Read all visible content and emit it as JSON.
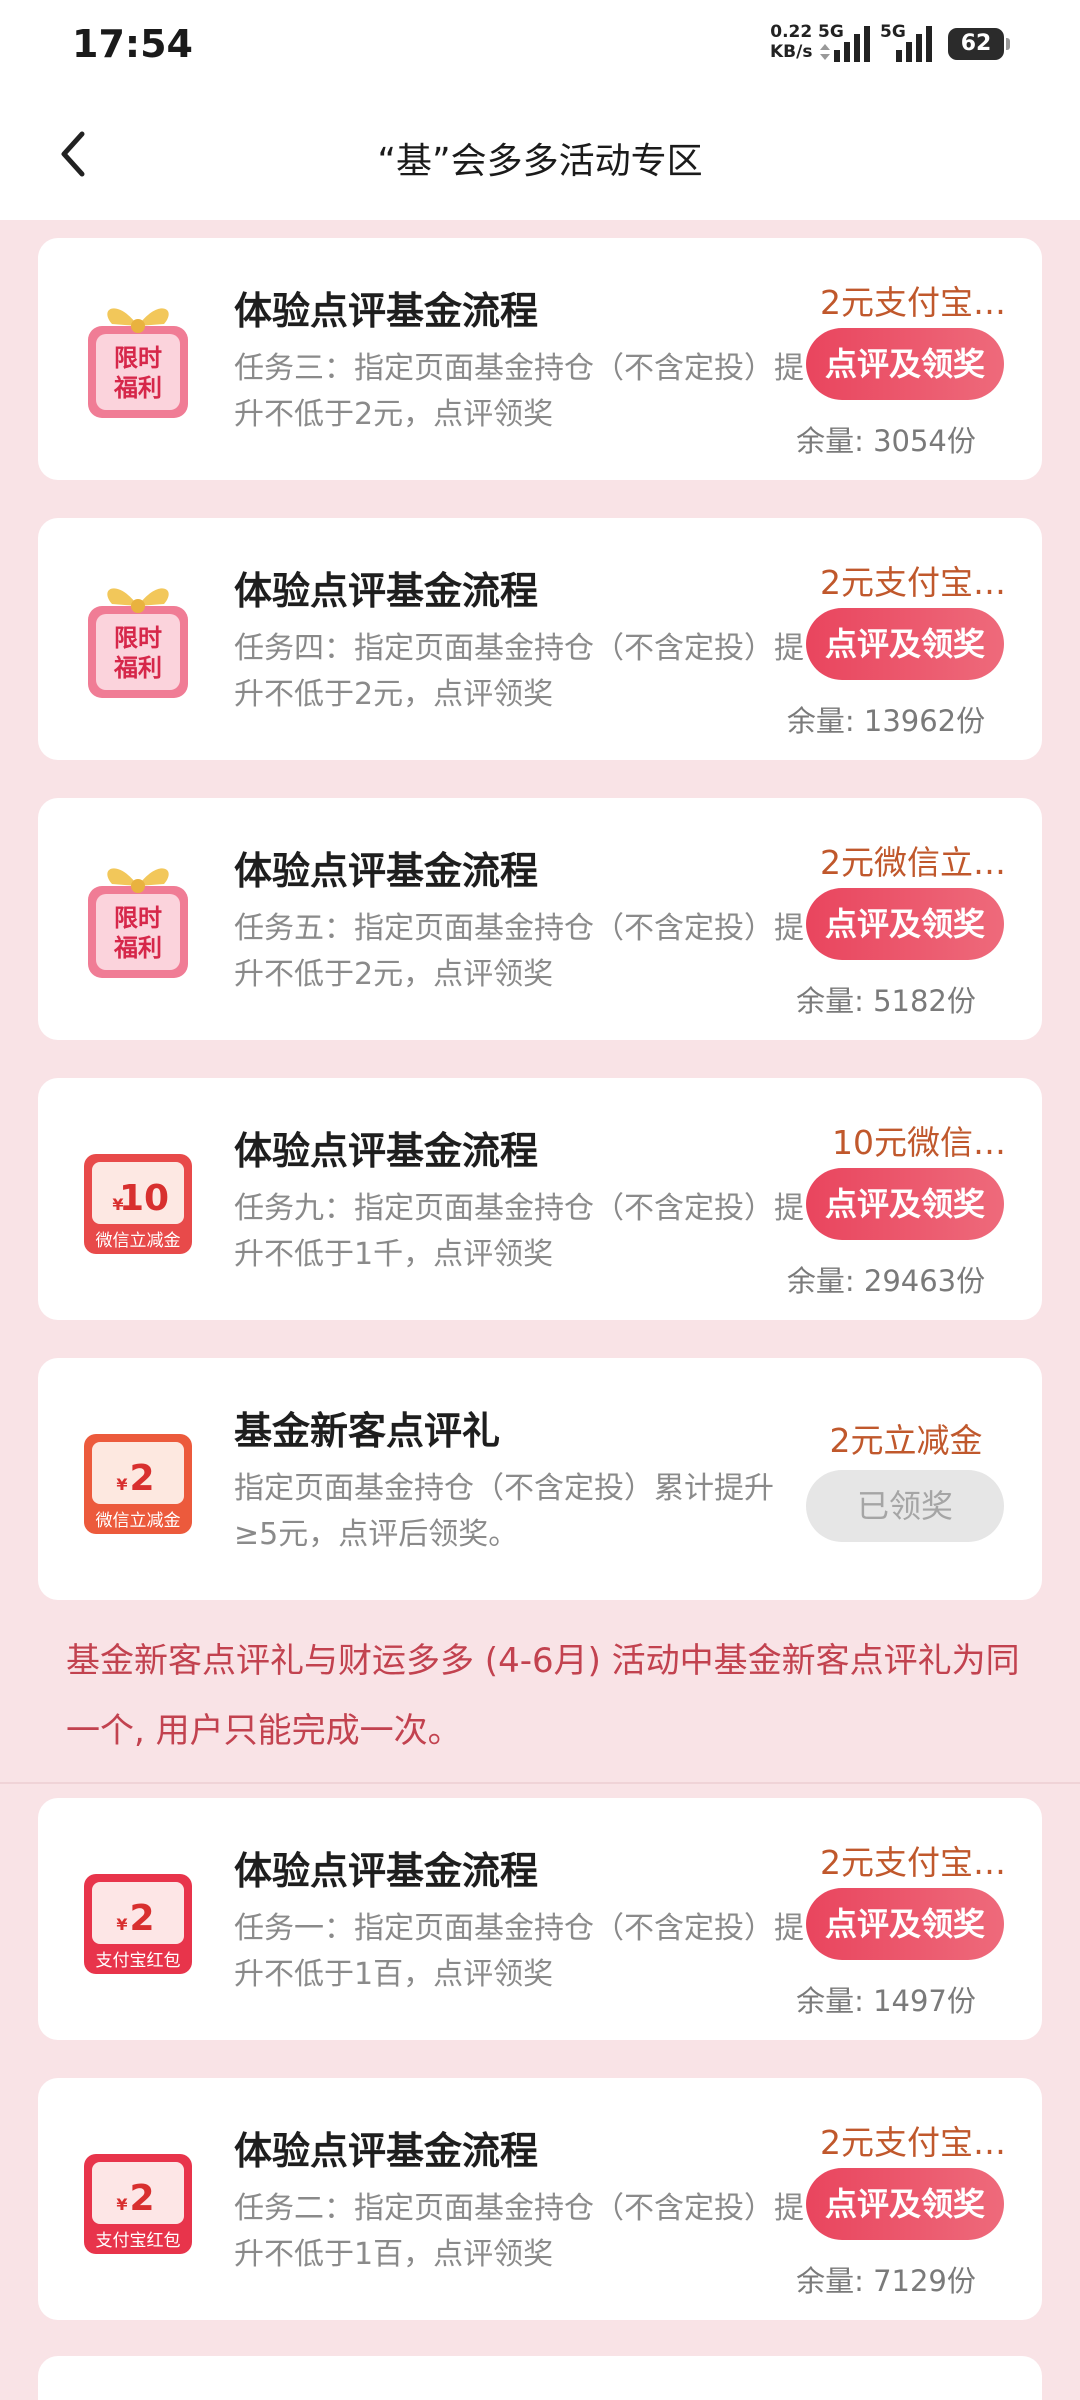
{
  "status_bar": {
    "time": "17:54",
    "speed_value": "0.22",
    "speed_unit": "KB/s",
    "network_1": "5G",
    "network_2": "5G",
    "battery": "62"
  },
  "nav": {
    "title": "“基”会多多活动专区"
  },
  "cards": [
    {
      "title": "体验点评基金流程",
      "desc": "任务三：指定页面基金持仓（不含定投）提升不低于2元，点评领奖",
      "reward": "2元支付宝…",
      "button": "点评及领奖",
      "stock": "余量: 3054份",
      "icon_type": "gift",
      "icon_line1": "限时",
      "icon_line2": "福利"
    },
    {
      "title": "体验点评基金流程",
      "desc": "任务四：指定页面基金持仓（不含定投）提升不低于2元，点评领奖",
      "reward": "2元支付宝…",
      "button": "点评及领奖",
      "stock": "余量: 13962份",
      "icon_type": "gift",
      "icon_line1": "限时",
      "icon_line2": "福利"
    },
    {
      "title": "体验点评基金流程",
      "desc": "任务五：指定页面基金持仓（不含定投）提升不低于2元，点评领奖",
      "reward": "2元微信立…",
      "button": "点评及领奖",
      "stock": "余量: 5182份",
      "icon_type": "gift",
      "icon_line1": "限时",
      "icon_line2": "福利"
    },
    {
      "title": "体验点评基金流程",
      "desc": "任务九：指定页面基金持仓（不含定投）提升不低于1千，点评领奖",
      "reward": "10元微信…",
      "button": "点评及领奖",
      "stock": "余量: 29463份",
      "icon_type": "coupon",
      "icon_amount": "10",
      "icon_currency": "¥",
      "icon_label": "微信立减金"
    },
    {
      "title": "基金新客点评礼",
      "desc": "指定页面基金持仓（不含定投）累计提升≥5元，点评后领奖。",
      "reward": "2元立减金",
      "button": "已领奖",
      "stock": "",
      "icon_type": "coupon",
      "icon_amount": "2",
      "icon_currency": "¥",
      "icon_label": "微信立减金"
    },
    {
      "title": "体验点评基金流程",
      "desc": "任务一：指定页面基金持仓（不含定投）提升不低于1百，点评领奖",
      "reward": "2元支付宝…",
      "button": "点评及领奖",
      "stock": "余量: 1497份",
      "icon_type": "coupon",
      "icon_amount": "2",
      "icon_currency": "¥",
      "icon_label": "支付宝红包"
    },
    {
      "title": "体验点评基金流程",
      "desc": "任务二：指定页面基金持仓（不含定投）提升不低于1百，点评领奖",
      "reward": "2元支付宝…",
      "button": "点评及领奖",
      "stock": "余量: 7129份",
      "icon_type": "coupon",
      "icon_amount": "2",
      "icon_currency": "¥",
      "icon_label": "支付宝红包"
    }
  ],
  "notice": "基金新客点评礼与财运多多 (4-6月) 活动中基金新客点评礼为同一个, 用户只能完成一次。",
  "colors": {
    "page_bg": "#f9e3e6",
    "accent_button": "#e9455e",
    "reward_text": "#c0582c",
    "notice_text": "#c2424f"
  }
}
